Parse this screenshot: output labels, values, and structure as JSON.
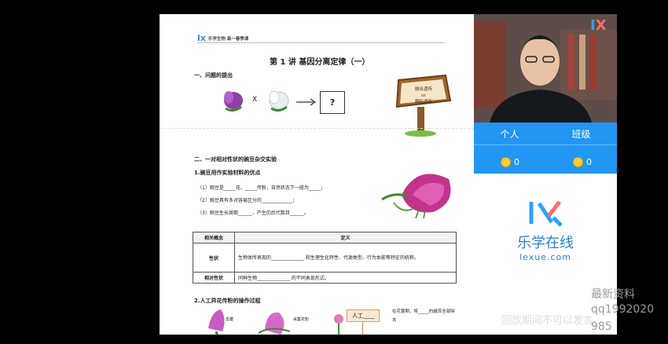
{
  "doc": {
    "brand_logo": "lx",
    "brand_text": "乐学生物  高一春季课",
    "title": "第 1 讲  基因分离定律（一）",
    "section1": "一、问题的提出",
    "cross_symbol": "X",
    "question_mark": "?",
    "sign_line1": "融合遗传",
    "sign_line2": "or",
    "sign_line3": "颗粒遗传",
    "section2": "二、一对相对性状的豌豆杂交实验",
    "sub1": "1.豌豆用作实验材料的优点",
    "item1": "（1）豌豆是_____花，_____传粉，自然状态下一般为_____；",
    "item2": "（2）豌豆具有多对容易区分的_____________；",
    "item3": "（3）豌豆生长周期______，产生的后代数目______。",
    "table": {
      "head_col1": "相关概念",
      "head_col2": "定义",
      "row1_term": "性状",
      "row1_def": "生物体所表现的______________ 和生理生化特性、代谢类型、行为本能等特征的统称。",
      "row2_term": "相对性状",
      "row2_def": "同种生物______________ 的不同表现形式。"
    },
    "sub2": "2.人工异花传粉的操作过程",
    "step_label1": "去雄",
    "step_label2": "采集花粉",
    "artificial_box": "人工____",
    "step_note": "在花蕾期，将_____的雌蕊全部除去"
  },
  "panel": {
    "tab_personal": "个人",
    "tab_class": "班级",
    "coin_personal": "0",
    "coin_class": "0",
    "logo_text": "乐学在线",
    "logo_url_text": "lexue.com"
  },
  "overlay": {
    "watermark1": "最新资料",
    "watermark2": "qq1992020",
    "watermark3": "985",
    "notice": "回放期间不可以发言"
  },
  "colors": {
    "accent": "#2196f3",
    "brand_blue": "#3a8fd6",
    "coin": "#ffcc33"
  }
}
